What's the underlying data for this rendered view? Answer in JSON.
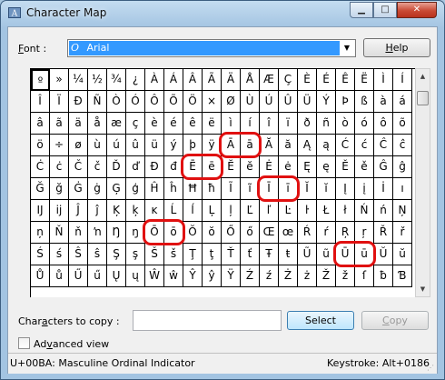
{
  "window": {
    "title": "Character Map",
    "min_glyph": "▁",
    "max_glyph": "□",
    "close_glyph": "✕"
  },
  "font": {
    "label_prefix": "",
    "label_underlined": "F",
    "label_rest": "ont :",
    "icon_glyph": "O",
    "selected": "Arial",
    "dropdown_glyph": "▼"
  },
  "help_button": {
    "prefix": "",
    "underlined": "H",
    "rest": "elp"
  },
  "grid": {
    "columns": 20,
    "rows": 10,
    "selected_index": 0,
    "chars": [
      "º",
      "»",
      "¼",
      "½",
      "¾",
      "¿",
      "À",
      "Á",
      "Â",
      "Ã",
      "Ä",
      "Å",
      "Æ",
      "Ç",
      "È",
      "É",
      "Ê",
      "Ë",
      "Ì",
      "Í",
      "Î",
      "Ï",
      "Ð",
      "Ñ",
      "Ò",
      "Ó",
      "Ô",
      "Õ",
      "Ö",
      "×",
      "Ø",
      "Ù",
      "Ú",
      "Û",
      "Ü",
      "Ý",
      "Þ",
      "ß",
      "à",
      "á",
      "â",
      "ã",
      "ä",
      "å",
      "æ",
      "ç",
      "è",
      "é",
      "ê",
      "ë",
      "ì",
      "í",
      "î",
      "ï",
      "ð",
      "ñ",
      "ò",
      "ó",
      "ô",
      "õ",
      "ö",
      "÷",
      "ø",
      "ù",
      "ú",
      "û",
      "ü",
      "ý",
      "þ",
      "ÿ",
      "Ā",
      "ā",
      "Ă",
      "ă",
      "Ą",
      "ą",
      "Ć",
      "ć",
      "Ĉ",
      "ĉ",
      "Ċ",
      "ċ",
      "Č",
      "č",
      "Ď",
      "ď",
      "Đ",
      "đ",
      "Ē",
      "ē",
      "Ĕ",
      "ĕ",
      "Ė",
      "ė",
      "Ę",
      "ę",
      "Ě",
      "ě",
      "Ĝ",
      "ĝ",
      "Ğ",
      "ğ",
      "Ġ",
      "ġ",
      "Ģ",
      "ģ",
      "Ĥ",
      "ĥ",
      "Ħ",
      "ħ",
      "Ĩ",
      "ĩ",
      "Ī",
      "ī",
      "Ĭ",
      "ĭ",
      "Į",
      "į",
      "İ",
      "ı",
      "Ĳ",
      "ĳ",
      "Ĵ",
      "ĵ",
      "Ķ",
      "ķ",
      "ĸ",
      "Ĺ",
      "ĺ",
      "Ļ",
      "ļ",
      "Ľ",
      "ľ",
      "Ŀ",
      "ŀ",
      "Ł",
      "ł",
      "Ń",
      "ń",
      "Ņ",
      "ņ",
      "Ň",
      "ň",
      "ŉ",
      "Ŋ",
      "ŋ",
      "Ō",
      "ō",
      "Ŏ",
      "ŏ",
      "Ő",
      "ő",
      "Œ",
      "œ",
      "Ŕ",
      "ŕ",
      "Ŗ",
      "ŗ",
      "Ř",
      "ř",
      "Ś",
      "ś",
      "Ŝ",
      "ŝ",
      "Ş",
      "ş",
      "Š",
      "š",
      "Ţ",
      "ţ",
      "Ť",
      "ť",
      "Ŧ",
      "ŧ",
      "Ũ",
      "ũ",
      "Ū",
      "ū",
      "Ŭ",
      "ŭ",
      "Ů",
      "ů",
      "Ű",
      "ű",
      "Ų",
      "ų",
      "Ŵ",
      "ŵ",
      "Ŷ",
      "ŷ",
      "Ÿ",
      "Ź",
      "ź",
      "Ż",
      "ż",
      "Ž",
      "ž",
      "ſ",
      "ƀ",
      "Ɓ"
    ],
    "highlighted_pairs": [
      {
        "first": "Ā",
        "second": "ā"
      },
      {
        "first": "Ē",
        "second": "ē"
      },
      {
        "first": "Ī",
        "second": "ī"
      },
      {
        "first": "Ō",
        "second": "ō"
      },
      {
        "first": "Ū",
        "second": "ū"
      }
    ],
    "highlight_color": "#e01010"
  },
  "scrollbar": {
    "up_glyph": "▲",
    "down_glyph": "▼"
  },
  "copy": {
    "label_prefix": "Char",
    "label_underlined": "a",
    "label_rest": "cters to copy :",
    "value": "",
    "select_label": "Select",
    "copy_prefix": "",
    "copy_underlined": "C",
    "copy_rest": "opy"
  },
  "advanced": {
    "label_prefix": "Ad",
    "label_underlined": "v",
    "label_rest": "anced view",
    "checked": false
  },
  "status": {
    "left": "U+00BA: Masculine Ordinal Indicator",
    "right": "Keystroke: Alt+0186",
    "grip_glyph": "⋰"
  }
}
